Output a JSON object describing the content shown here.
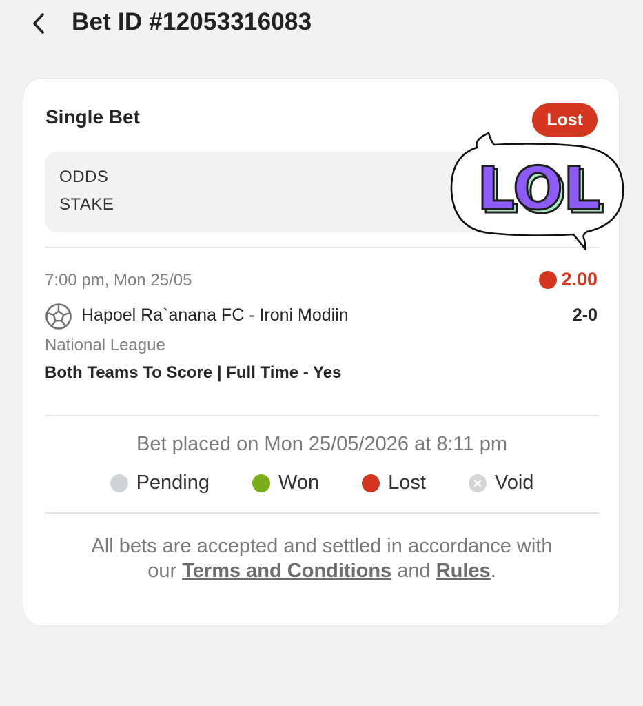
{
  "header": {
    "title": "Bet ID #12053316083"
  },
  "card": {
    "title": "Single Bet",
    "status": "Lost",
    "summary": {
      "odds_label": "ODDS",
      "stake_label": "STAKE"
    },
    "selection": {
      "time": "7:00 pm, Mon 25/05",
      "odds": "2.00",
      "match": "Hapoel Ra`anana FC - Ironi Modiin",
      "score": "2-0",
      "league": "National League",
      "market": "Both Teams To Score | Full Time - Yes"
    },
    "placed": "Bet placed on Mon 25/05/2026 at 8:11 pm",
    "legend": {
      "pending": "Pending",
      "won": "Won",
      "lost": "Lost",
      "void": "Void"
    },
    "footer": {
      "line1": "All bets are accepted and settled in accordance with",
      "our": "our ",
      "terms_link": "Terms and Conditions",
      "and": " and ",
      "rules_link": "Rules",
      "period": "."
    }
  },
  "sticker": {
    "text": "LOL"
  },
  "colors": {
    "lost": "#d4361f",
    "won": "#7aad1a",
    "pending": "#cfd3d5",
    "void": "#d5d5d5",
    "background": "#f2f2f3",
    "sticker_purple": "#8d5cf6",
    "sticker_green": "#a6ecc0"
  },
  "icons": {
    "back": "chevron-left-icon",
    "sport": "soccer-ball-icon",
    "void": "x-circle-icon"
  }
}
